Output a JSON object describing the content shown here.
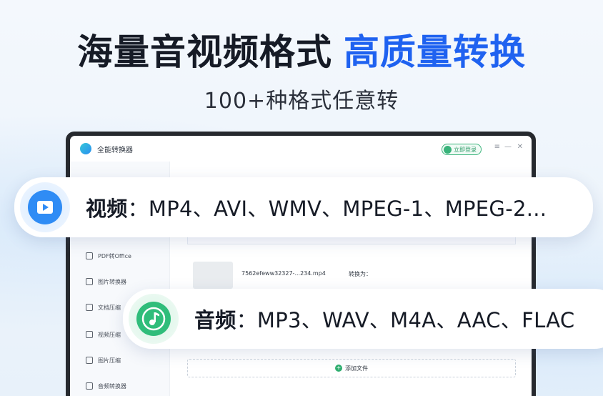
{
  "headline": {
    "dark": "海量音视频格式",
    "blue": "高质量转换"
  },
  "subline": "100+种格式任意转",
  "app": {
    "name": "全能转换器",
    "login_label": "立即登录",
    "sidebar": [
      {
        "label": "PDF转Office"
      },
      {
        "label": "图片转换器"
      },
      {
        "label": "文档压缩"
      },
      {
        "label": "视频压缩"
      },
      {
        "label": "图片压缩"
      },
      {
        "label": "音频转换器"
      }
    ],
    "file": {
      "name": "7562efeww32327-...234.mp4",
      "convert_label": "转换为："
    },
    "add_file_label": "添加文件"
  },
  "video_callout": {
    "title": "视频",
    "formats": "：MP4、AVI、WMV、MPEG-1、MPEG-2..."
  },
  "audio_callout": {
    "title": "音频",
    "formats": "：MP3、WAV、M4A、AAC、FLAC"
  },
  "colors": {
    "accent_blue": "#1f62f0",
    "video_icon": "#2f8cf5",
    "audio_icon": "#2fbd7a"
  }
}
